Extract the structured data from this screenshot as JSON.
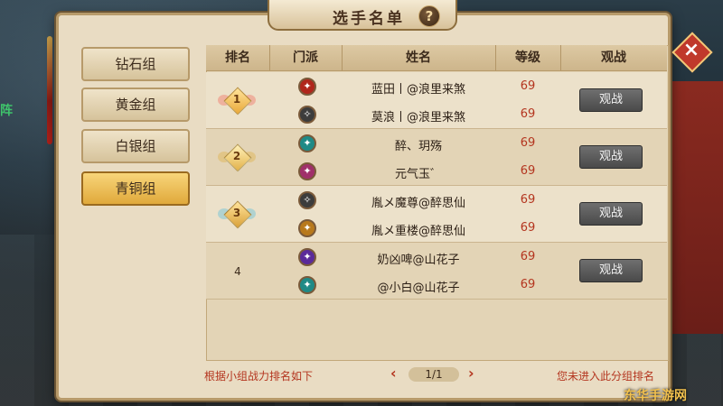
{
  "title": "选手名单",
  "help_icon": "?",
  "close_icon": "×",
  "side_text": "阵",
  "sidebar": {
    "tabs": [
      {
        "label": "钻石组",
        "active": false
      },
      {
        "label": "黄金组",
        "active": false
      },
      {
        "label": "白银组",
        "active": false
      },
      {
        "label": "青铜组",
        "active": true
      }
    ]
  },
  "table": {
    "headers": [
      "排名",
      "门派",
      "姓名",
      "等级",
      "观战"
    ],
    "groups": [
      {
        "rank": "1",
        "watch_label": "观战",
        "players": [
          {
            "sect_icon": "red-sect-icon",
            "name": "蓝田丨@浪里来煞",
            "level": "69"
          },
          {
            "sect_icon": "white-sect-icon",
            "name": "莫浪丨@浪里来煞",
            "level": "69"
          }
        ]
      },
      {
        "rank": "2",
        "watch_label": "观战",
        "players": [
          {
            "sect_icon": "teal-sect-icon",
            "name": "醉、玥殇",
            "level": "69"
          },
          {
            "sect_icon": "pink-sect-icon",
            "name": "元气玉゛",
            "level": "69"
          }
        ]
      },
      {
        "rank": "3",
        "watch_label": "观战",
        "players": [
          {
            "sect_icon": "white-sect-icon",
            "name": "胤メ魔尊@醉思仙",
            "level": "69"
          },
          {
            "sect_icon": "gold-sect-icon",
            "name": "胤メ重楼@醉思仙",
            "level": "69"
          }
        ]
      },
      {
        "rank": "4",
        "watch_label": "观战",
        "players": [
          {
            "sect_icon": "purple-sect-icon",
            "name": "奶凶啤@山花子",
            "level": "69"
          },
          {
            "sect_icon": "teal-sect-icon",
            "name": "@小白@山花子",
            "level": "69"
          }
        ]
      }
    ]
  },
  "footer": {
    "left_note": "根据小组战力排名如下",
    "pager": "1/1",
    "prev": "‹",
    "next": "›",
    "right_note": "您未进入此分组排名"
  },
  "watermark": "东华手游网",
  "colors": {
    "accent_red": "#b4351f",
    "active_tab": "#e0a93b",
    "panel_bg": "#e9dcc3"
  }
}
